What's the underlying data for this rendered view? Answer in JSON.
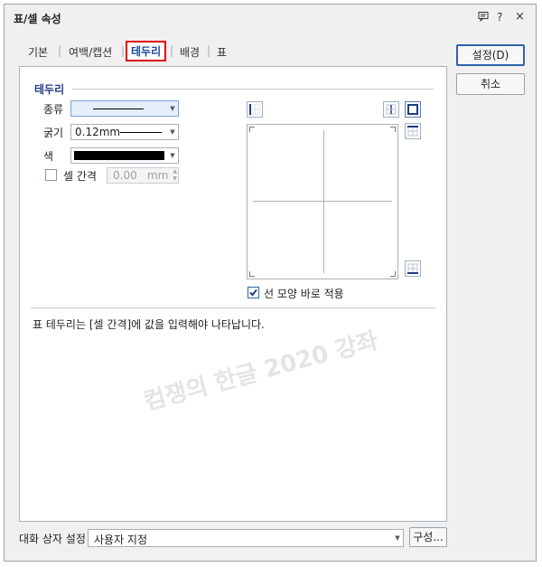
{
  "window": {
    "title": "표/셀 속성",
    "controls": {
      "menu_icon": "message-icon",
      "help": "?",
      "close": "×"
    }
  },
  "tabs": [
    {
      "label": "기본",
      "active": false
    },
    {
      "label": "여백/캡션",
      "active": false
    },
    {
      "label": "테두리",
      "active": true
    },
    {
      "label": "배경",
      "active": false
    },
    {
      "label": "표",
      "active": false
    }
  ],
  "buttons": {
    "ok": "설정(D)",
    "cancel": "취소",
    "compose": "구성..."
  },
  "border": {
    "section_title": "테두리",
    "type_label": "종류",
    "width_label": "굵기",
    "width_value": "0.12mm",
    "color_label": "색",
    "color_value": "#000000",
    "cell_spacing_label": "셀 간격",
    "cell_spacing_value": "0.00",
    "cell_spacing_unit": "mm",
    "cell_spacing_checked": false,
    "apply_immediately_label": "선 모양 바로 적용",
    "apply_immediately_checked": true
  },
  "info_text": "표 테두리는 [셀 간격]에 값을 입력해야 나타납니다.",
  "footer": {
    "dialog_setting_label": "대화 상자 설정",
    "dialog_setting_value": "사용자 지정"
  },
  "watermark": "컴쟁의 한글 2020 강좌"
}
